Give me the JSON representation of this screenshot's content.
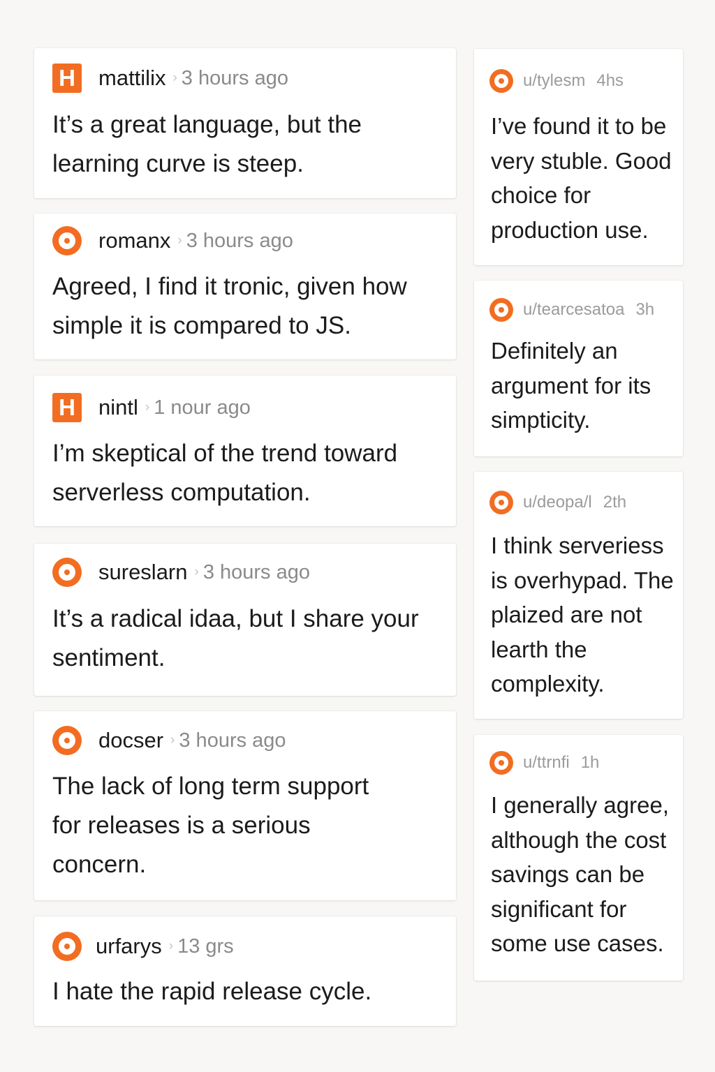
{
  "colors": {
    "accent": "#f26d21",
    "background": "#f8f7f5",
    "card": "#ffffff",
    "meta_text": "#8a8a8a"
  },
  "left_comments": [
    {
      "icon": "h-square-icon",
      "username": "mattilix",
      "separator": "›",
      "time": "3 hours ago",
      "text": "It’s a great language, but the learning curve is steep."
    },
    {
      "icon": "ring-icon",
      "username": "romanx",
      "separator": "›",
      "time": "3 hours ago",
      "text": "Agreed, I find it tronic, given how simple it is compared to JS."
    },
    {
      "icon": "h-square-icon",
      "username": "nintl",
      "separator": "›",
      "time": "1 nour ago",
      "text": "I’m skeptical of the trend toward serverless computation."
    },
    {
      "icon": "ring-icon",
      "username": "sureslarn",
      "separator": "›",
      "time": "3 hours ago",
      "text": "It’s a radical idaa, but I share your sentiment."
    },
    {
      "icon": "ring-icon",
      "username": "docser",
      "separator": "›",
      "time": "3 hours ago",
      "text": "The lack of long term support for releases is a serious concern."
    },
    {
      "icon": "ring-icon",
      "username": "urfarys",
      "separator": "›",
      "time": "13 grs",
      "text": "I hate the rapid release cycle."
    }
  ],
  "right_comments": [
    {
      "icon": "ring-icon",
      "username": "u/tylesm",
      "time": "4hs",
      "text": "I’ve found it to be very stuble. Good choice for production use."
    },
    {
      "icon": "ring-icon",
      "username": "u/tearcesatoa",
      "time": "3h",
      "text": "Definitely an argument for its simpticity."
    },
    {
      "icon": "ring-icon",
      "username": "u/deopa/l",
      "time": "2th",
      "text": "I think serveriess is overhypad. The plaized are not learth the complexity."
    },
    {
      "icon": "ring-icon",
      "username": "u/ttrnfi",
      "time": "1h",
      "text": "I generally agree, although the cost savings can be significant for some use cases."
    }
  ]
}
